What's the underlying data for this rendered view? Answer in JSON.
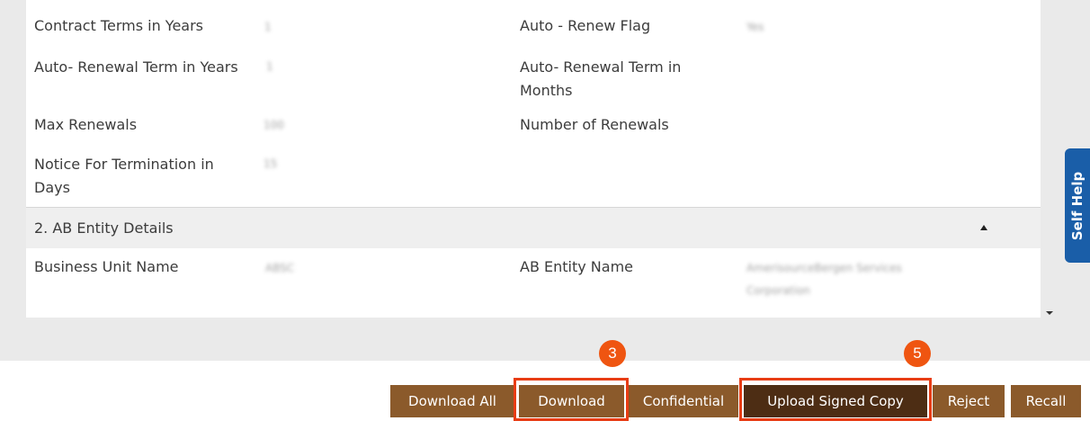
{
  "contract_details": {
    "contract_terms_label": "Contract Terms in Years",
    "contract_terms_value": "1",
    "auto_renew_flag_label": "Auto - Renew Flag",
    "auto_renew_flag_value": "Yes",
    "renewal_term_years_label": "Auto- Renewal Term in Years",
    "renewal_term_years_value": "1",
    "renewal_term_months_label_line1": "Auto- Renewal Term in",
    "renewal_term_months_label_line2": "Months",
    "max_renewals_label": "Max Renewals",
    "max_renewals_value": "100",
    "number_of_renewals_label": "Number of Renewals",
    "notice_termination_label_line1": "Notice For Termination in",
    "notice_termination_label_line2": "Days",
    "notice_termination_value": "15"
  },
  "ab_entity_section": {
    "title": "2. AB Entity Details",
    "business_unit_label": "Business Unit Name",
    "business_unit_value": "ABSC",
    "ab_entity_name_label": "AB Entity Name",
    "ab_entity_name_value_line1": "AmerisourceBergen Services",
    "ab_entity_name_value_line2": "Corporation"
  },
  "self_help": {
    "label": "Self Help"
  },
  "actions": {
    "download_all": "Download All",
    "download": "Download",
    "confidential": "Confidential",
    "upload_signed_copy": "Upload Signed Copy",
    "reject": "Reject",
    "recall": "Recall"
  },
  "annotations": {
    "download_step": "3",
    "upload_step": "5"
  },
  "colors": {
    "button_brown": "#8b5a2b",
    "button_dark_brown": "#4d2d14",
    "highlight_red": "#e83d15",
    "badge_orange": "#ef5511",
    "self_help_blue": "#1a5ea8"
  }
}
